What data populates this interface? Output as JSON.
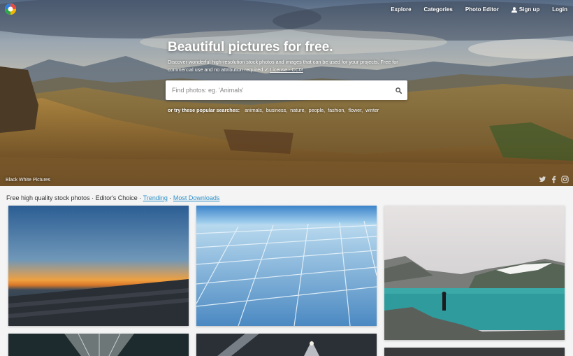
{
  "nav": {
    "items": [
      {
        "label": "Explore"
      },
      {
        "label": "Categories"
      },
      {
        "label": "Photo Editor"
      },
      {
        "label": "Sign up",
        "icon": "user-icon"
      },
      {
        "label": "Login"
      }
    ]
  },
  "hero": {
    "title": "Beautiful pictures for free.",
    "description": "Discover wonderful high-resolution stock photos and images that can be used for your projects. Free for commercial use and no attribution required ✓",
    "license_link": "License - CC0!",
    "search_placeholder": "Find photos: eg. 'Animals'",
    "popular_lead": "or try these popular searches:",
    "popular_searches": [
      "animals,",
      "business,",
      "nature,",
      "people,",
      "fashion,",
      "flower,",
      "winter"
    ],
    "credit": "Black White Pictures",
    "social_icons": [
      "twitter-icon",
      "facebook-icon",
      "instagram-icon"
    ]
  },
  "filters": {
    "static_text": "Free high quality stock photos · Editor's Choice ·",
    "trending": "Trending",
    "separator": "·",
    "most_downloads": "Most Downloads"
  },
  "colors": {
    "link": "#2a8fc9",
    "background": "#f4f4f4"
  }
}
